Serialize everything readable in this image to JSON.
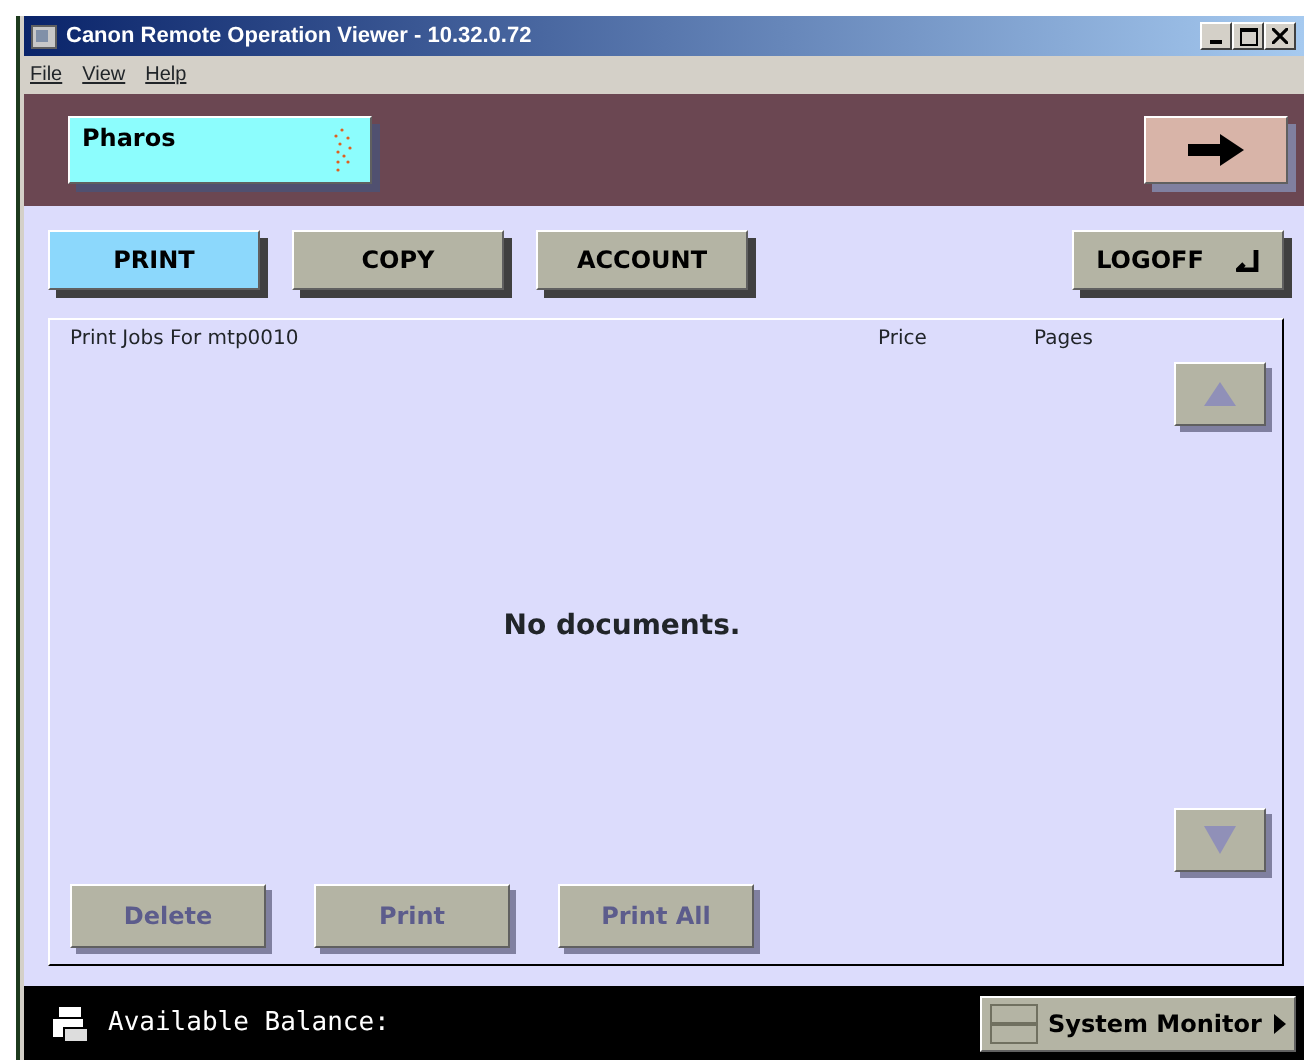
{
  "window": {
    "title": "Canon Remote Operation Viewer - 10.32.0.72"
  },
  "menu": [
    "File",
    "View",
    "Help"
  ],
  "header": {
    "logo": "Pharos"
  },
  "tabs": [
    {
      "label": "PRINT",
      "selected": true
    },
    {
      "label": "COPY",
      "selected": false
    },
    {
      "label": "ACCOUNT",
      "selected": false
    }
  ],
  "logoff": "LOGOFF",
  "list": {
    "title": "Print Jobs For mtp0010",
    "columns": [
      "Price",
      "Pages"
    ],
    "empty_message": "No documents."
  },
  "actions": [
    {
      "label": "Delete",
      "disabled": true
    },
    {
      "label": "Print",
      "disabled": true
    },
    {
      "label": "Print All",
      "disabled": true
    }
  ],
  "status_bar": {
    "balance_label": "Available Balance:",
    "monitor": "System Monitor"
  }
}
